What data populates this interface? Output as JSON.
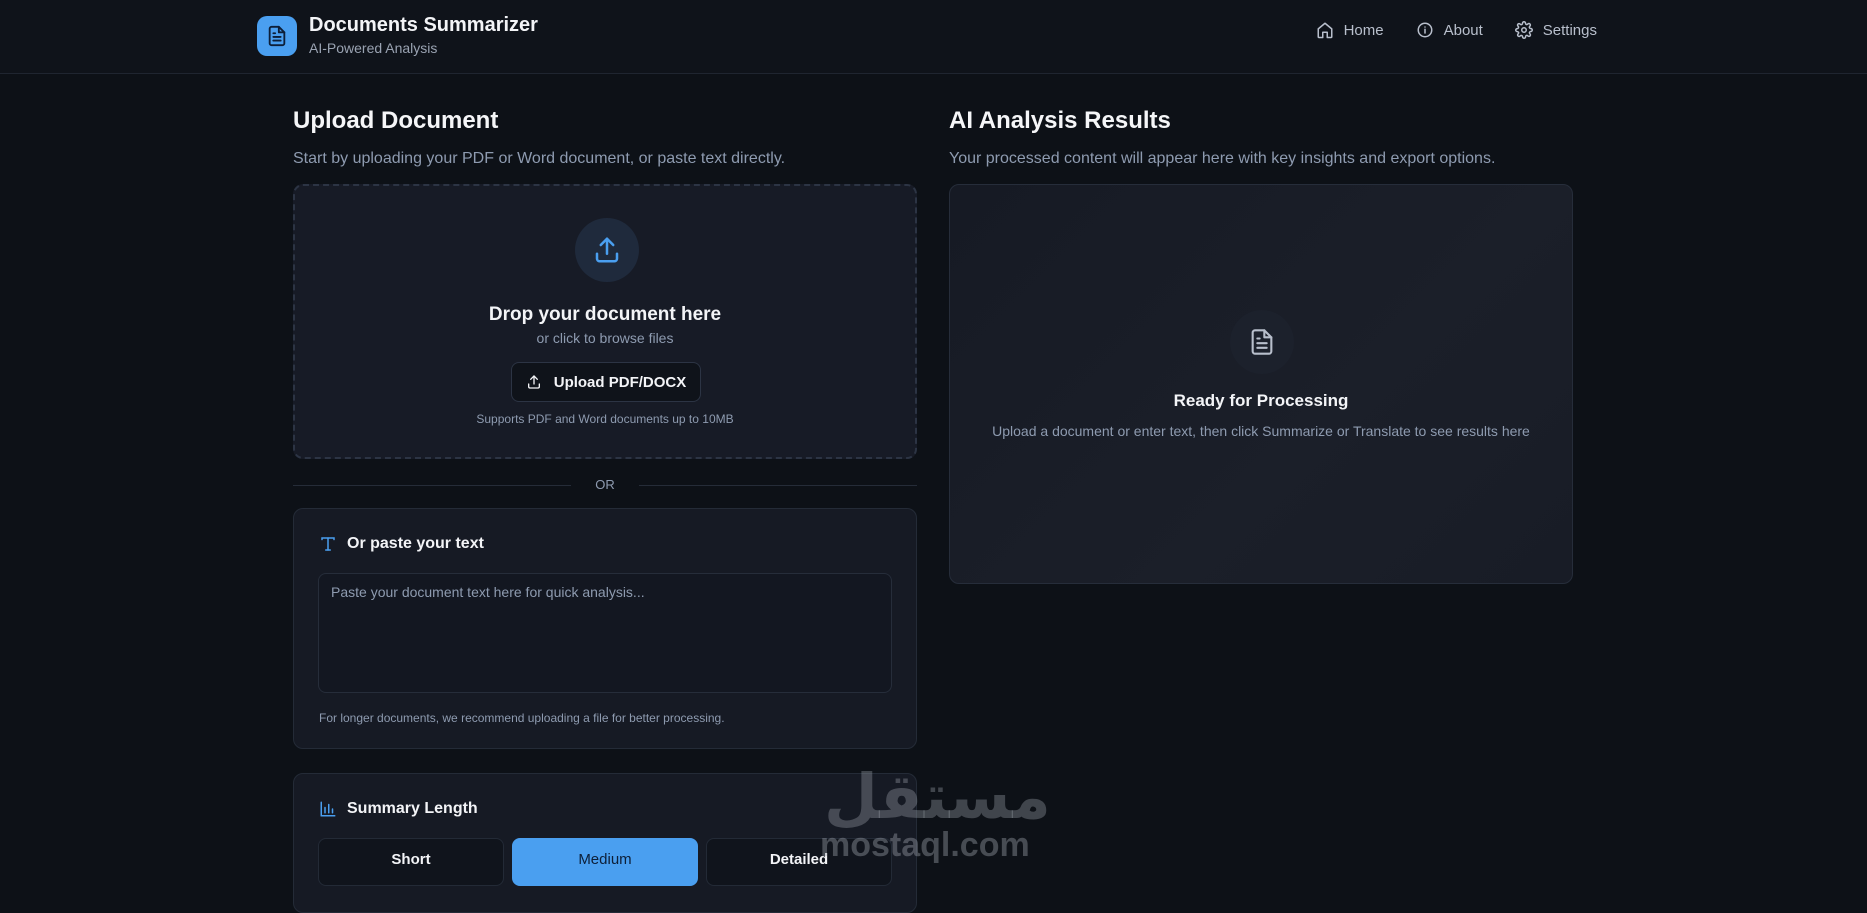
{
  "header": {
    "title": "Documents Summarizer",
    "subtitle": "AI-Powered Analysis",
    "logo_icon": "document-icon",
    "accent": "#4a9ff0",
    "nav": [
      {
        "label": "Home",
        "icon": "home-icon"
      },
      {
        "label": "About",
        "icon": "info-icon"
      },
      {
        "label": "Settings",
        "icon": "gear-icon"
      }
    ]
  },
  "upload": {
    "title": "Upload Document",
    "description": "Start by uploading your PDF or Word document, or paste text directly.",
    "drop_title": "Drop your document here",
    "drop_sub": "or click to browse files",
    "button_label": "Upload PDF/DOCX",
    "note": "Supports PDF and Word documents up to 10MB"
  },
  "divider": {
    "label": "OR"
  },
  "paste": {
    "title": "Or paste your text",
    "placeholder": "Paste your document text here for quick analysis...",
    "note": "For longer documents, we recommend uploading a file for better processing."
  },
  "summary": {
    "title": "Summary Length",
    "options": [
      "Short",
      "Medium",
      "Detailed"
    ],
    "selected": "Medium"
  },
  "results": {
    "title": "AI Analysis Results",
    "description": "Your processed content will appear here with key insights and export options.",
    "empty_title": "Ready for Processing",
    "empty_desc": "Upload a document or enter text, then click Summarize or Translate to see results here"
  },
  "watermark": {
    "arabic": "مستقل",
    "latin": "mostaql.com"
  }
}
